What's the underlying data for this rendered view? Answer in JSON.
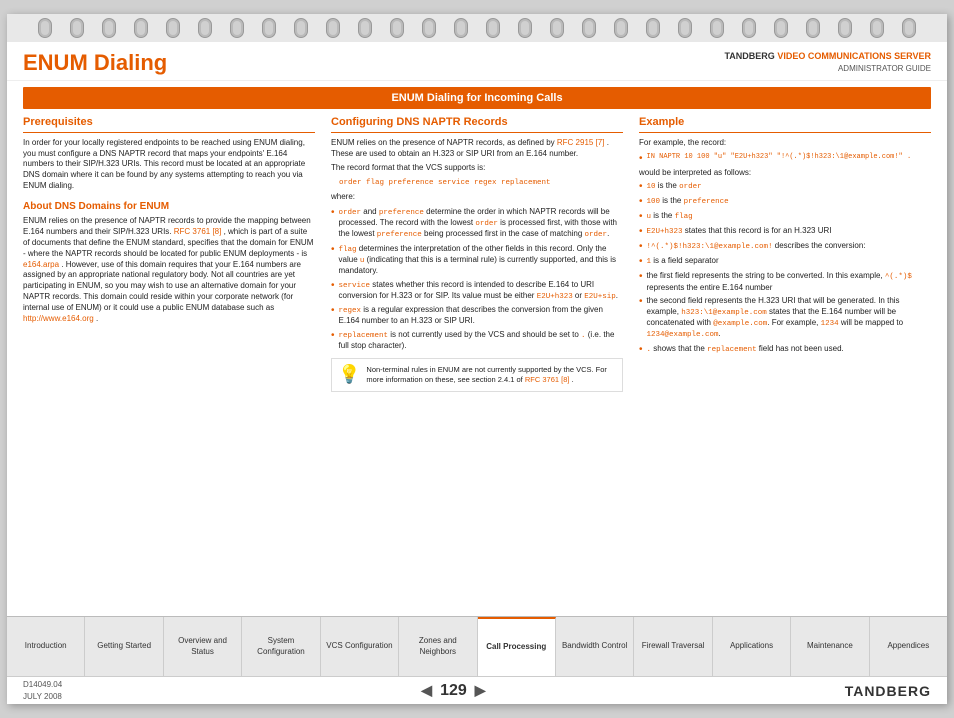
{
  "header": {
    "title": "ENUM Dialing",
    "company": "TANDBERG",
    "product_highlight": "VIDEO COMMUNICATIONS SERVER",
    "subtitle": "ADMINISTRATOR GUIDE"
  },
  "section_bar": {
    "label": "ENUM Dialing for Incoming Calls"
  },
  "col1": {
    "header": "Prerequisites",
    "intro": "In order for your locally registered endpoints to be reached using ENUM dialing, you must configure a DNS NAPTR record that maps your endpoints' E.164 numbers to their SIP/H.323 URIs. This record must be located at an appropriate DNS domain where it can be found by any systems attempting to reach you via ENUM dialing.",
    "subheader": "About DNS Domains for ENUM",
    "body": "ENUM relies on the presence of NAPTR records to provide the mapping between E.164 numbers and their SIP/H.323 URIs.",
    "link1": "RFC 3761 [8]",
    "body2": ", which is part of a suite of documents that define the ENUM standard, specifies that the domain for ENUM - where the NAPTR records should be located for public ENUM deployments - is",
    "link2": "e164.arpa",
    "body3": ". However, use of this domain requires that your E.164 numbers are assigned by an appropriate national regulatory body. Not all countries are yet participating in ENUM, so you may wish to use an alternative domain for your NAPTR records.  This domain could reside within your corporate network (for internal use of ENUM) or it could use a public ENUM database such as",
    "link3": "http://www.e164.org",
    "body4": "."
  },
  "col2": {
    "header": "Configuring DNS NAPTR Records",
    "intro": "ENUM relies on the presence of NAPTR records, as defined by",
    "link_rfc": "RFC 2915 [7]",
    "intro2": ". These are used to obtain an H.323 or SIP URI from an E.164 number.",
    "record_format": "The record format that the VCS supports is:",
    "code_block": "order flag preference service regex replacement",
    "where": "where:",
    "bullets": [
      {
        "term": "order",
        "connector": " and ",
        "term2": "preference",
        "desc": " determine the order in which NAPTR records will be processed.  The record with the lowest ",
        "term3": "order",
        "desc2": " is processed first, with those with the lowest ",
        "term4": "preference",
        "desc3": " being processed first in the case of matching ",
        "term5": "order",
        "desc4": "."
      },
      {
        "term": "flag",
        "desc": " determines the interpretation of the other fields in this record. Only the value ",
        "term2": "u",
        "desc2": " (indicating that this is a terminal rule) is currently supported, and this is mandatory."
      },
      {
        "term": "service",
        "desc": " states whether this record is intended to describe E.164 to URI conversion for H.323 or for SIP. Its value must be either ",
        "term2": "E2U+h323",
        "connector": " or ",
        "term3": "E2U+sip",
        "desc2": "."
      },
      {
        "term": "regex",
        "desc": " is a regular expression that describes the conversion from the given E.164 number to an H.323 or SIP URI."
      },
      {
        "term": "replacement",
        "desc": " is not currently used by the VCS and should be set to ",
        "term2": ".",
        "desc2": " (i.e. the full stop character)."
      }
    ],
    "note": "Non-terminal rules in ENUM are not currently supported by the VCS.  For more information on these, see section 2.4.1 of ",
    "note_link": "RFC 3761 [8]",
    "note_end": "."
  },
  "col3": {
    "header": "Example",
    "intro": "For example, the record:",
    "example_record": "IN NAPTR 10 100 \"u\" \"E2U+h323\" \"!^(.*)$!h323:\\1@example.com!\" .",
    "would": "would be interpreted as follows:",
    "bullets": [
      {
        "term": "10",
        "desc": " is the ",
        "term2": "order"
      },
      {
        "term": "100",
        "desc": " is the ",
        "term2": "preference"
      },
      {
        "term": "u",
        "desc": " is the ",
        "term2": "flag"
      },
      {
        "term": "E2U+h323",
        "desc": " states that this record is for an H.323 URI"
      },
      {
        "term": "!^(.*)$!h323:\\1@example.com!",
        "desc": " describes the conversion:"
      },
      {
        "term": "1",
        "desc": " is a field separator"
      },
      "the first field represents the string to be converted.  In this example, ^(.*)$ represents the entire E.164 number",
      {
        "desc2": "the second field represents the H.323 URI that will be generated. In this example, ",
        "term": "h323:\\1@example.com",
        "desc3": " states that the E.164 number will be concatenated with ",
        "term2": "@example.com",
        "desc4": ".  For example, ",
        "term3": "1234",
        "desc5": " will be mapped to ",
        "term4": "1234@example.com",
        "desc6": "."
      },
      {
        "term": ".",
        "desc": " shows that the ",
        "term2": "replacement",
        "desc2": " field has not been used."
      }
    ]
  },
  "nav_tabs": [
    {
      "id": "introduction",
      "label": "Introduction",
      "active": false
    },
    {
      "id": "getting-started",
      "label": "Getting Started",
      "active": false
    },
    {
      "id": "overview-status",
      "label": "Overview and Status",
      "active": false
    },
    {
      "id": "system-config",
      "label": "System Configuration",
      "active": false
    },
    {
      "id": "vcs-config",
      "label": "VCS Configuration",
      "active": false
    },
    {
      "id": "zones-neighbors",
      "label": "Zones and Neighbors",
      "active": false
    },
    {
      "id": "call-processing",
      "label": "Call Processing",
      "active": true
    },
    {
      "id": "bandwidth-control",
      "label": "Bandwidth Control",
      "active": false
    },
    {
      "id": "firewall-traversal",
      "label": "Firewall Traversal",
      "active": false
    },
    {
      "id": "applications",
      "label": "Applications",
      "active": false
    },
    {
      "id": "maintenance",
      "label": "Maintenance",
      "active": false
    },
    {
      "id": "appendices",
      "label": "Appendices",
      "active": false
    }
  ],
  "footer": {
    "doc_id": "D14049.04",
    "date": "JULY 2008",
    "page_number": "129",
    "brand": "TANDBERG"
  },
  "spiral": {
    "count": 28
  }
}
